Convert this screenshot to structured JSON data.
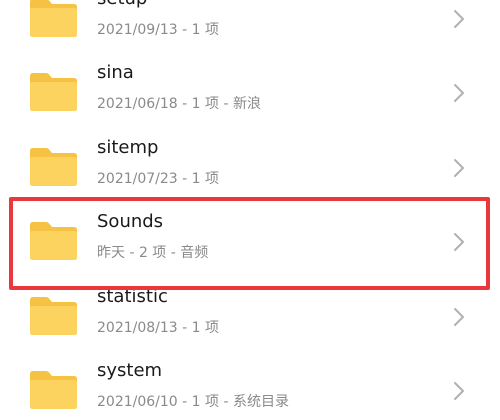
{
  "files": [
    {
      "name": "setup",
      "date": "2021/09/13",
      "count": "1 项",
      "tag": ""
    },
    {
      "name": "sina",
      "date": "2021/06/18",
      "count": "1 项",
      "tag": "新浪"
    },
    {
      "name": "sitemp",
      "date": "2021/07/23",
      "count": "1 项",
      "tag": ""
    },
    {
      "name": "Sounds",
      "date": "昨天",
      "count": "2 项",
      "tag": "音频"
    },
    {
      "name": "statistic",
      "date": "2021/08/13",
      "count": "1 项",
      "tag": ""
    },
    {
      "name": "system",
      "date": "2021/06/10",
      "count": "1 项",
      "tag": "系统目录"
    }
  ],
  "selected_index": 3,
  "colors": {
    "folder_back": "#f6c244",
    "folder_front": "#fdd35f",
    "highlight_border": "#e8383d",
    "chevron": "#b0b0b0",
    "name_text": "#1a1a1a",
    "meta_text": "#8a8a8a"
  },
  "icons": {
    "folder": "folder-icon",
    "chevron": "chevron-right-icon"
  }
}
